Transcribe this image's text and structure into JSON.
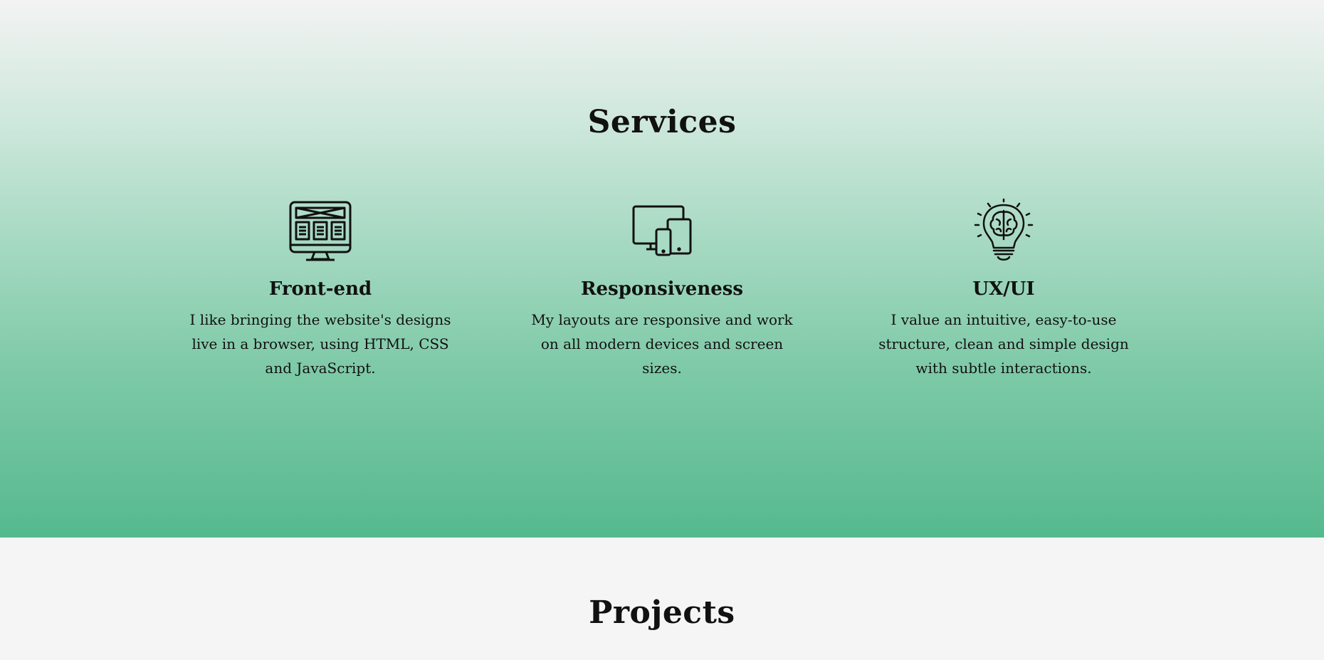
{
  "menu": {
    "icon": "hamburger-menu-icon",
    "color": "#5cb992"
  },
  "services": {
    "title": "Services",
    "items": [
      {
        "icon": "desktop-monitor-icon",
        "title": "Front-end",
        "description": "I like bringing the website's designs live in a browser, using HTML, CSS and JavaScript."
      },
      {
        "icon": "responsive-devices-icon",
        "title": "Responsiveness",
        "description": "My layouts are responsive and work on all modern devices and screen sizes."
      },
      {
        "icon": "lightbulb-brain-icon",
        "title": "UX/UI",
        "description": "I value an intuitive, easy-to-use structure, clean and simple design with subtle interactions."
      }
    ],
    "gradient": [
      "#f3f3f3",
      "#55b98e"
    ]
  },
  "projects": {
    "title": "Projects"
  }
}
